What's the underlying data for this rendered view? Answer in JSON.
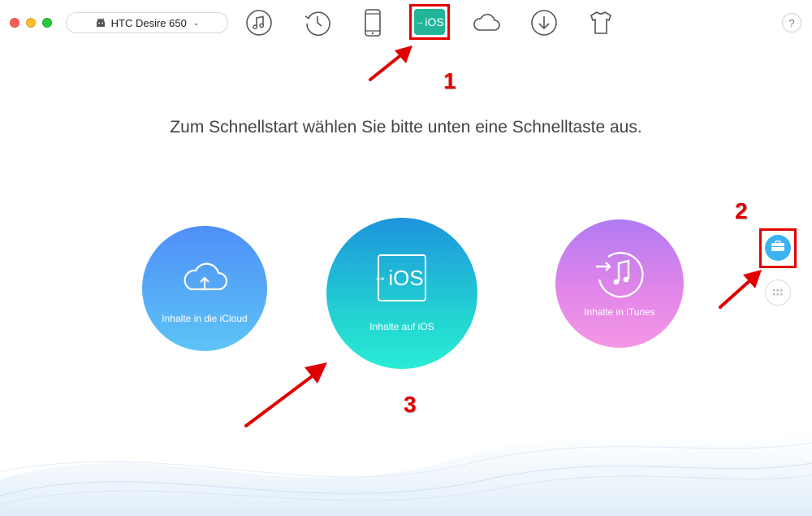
{
  "window": {
    "traffic_lights": [
      "close",
      "minimize",
      "zoom"
    ]
  },
  "device": {
    "name": "HTC Desire 650",
    "icon": "android-icon",
    "chevron": "⌄"
  },
  "toolbar": {
    "items": [
      {
        "name": "music-icon"
      },
      {
        "name": "history-icon"
      },
      {
        "name": "phone-icon"
      },
      {
        "name": "ios-mover-icon",
        "label": "iOS",
        "arrow": "→",
        "color": "#22b59a"
      },
      {
        "name": "cloud-icon"
      },
      {
        "name": "download-icon"
      },
      {
        "name": "tshirt-icon"
      }
    ],
    "help": "?"
  },
  "headline": "Zum Schnellstart wählen Sie bitte unten eine Schnelltaste aus.",
  "quick_buttons": {
    "icloud": {
      "label": "Inhalte in die iCloud",
      "icon": "cloud-upload-icon"
    },
    "ios": {
      "label": "Inhalte auf iOS",
      "icon_text": "iOS",
      "arrow": "→"
    },
    "itunes": {
      "label": "Inhalte in iTunes",
      "icon": "itunes-icon"
    }
  },
  "side_buttons": {
    "toolbox": {
      "icon": "toolbox-icon",
      "color": "#3cb2f0"
    },
    "grid": {
      "icon": "grid-icon"
    }
  },
  "annotations": {
    "step1": "1",
    "step2": "2",
    "step3": "3",
    "color": "#e30000"
  }
}
